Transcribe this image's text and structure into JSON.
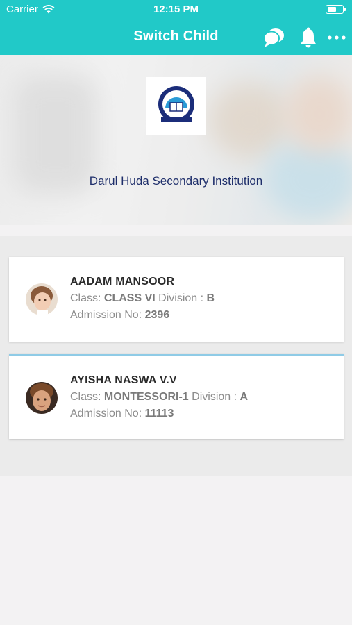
{
  "status_bar": {
    "carrier": "Carrier",
    "time": "12:15 PM"
  },
  "nav": {
    "title": "Switch Child",
    "icons": [
      "chat-icon",
      "bell-icon",
      "more-icon"
    ]
  },
  "school": {
    "name": "Darul Huda Secondary Institution",
    "logo": "school-logo"
  },
  "children": [
    {
      "name": "AADAM MANSOOR",
      "class_label": "Class:",
      "class": "CLASS VI",
      "division_label": "Division :",
      "division": "B",
      "admission_label": "Admission No:",
      "admission_no": "2396"
    },
    {
      "name": "AYISHA NASWA V.V",
      "class_label": "Class:",
      "class": "MONTESSORI-1",
      "division_label": "Division :",
      "division": "A",
      "admission_label": "Admission No:",
      "admission_no": "11113"
    }
  ],
  "colors": {
    "nav": "#21c9c8",
    "school_name": "#1f2f6b"
  }
}
